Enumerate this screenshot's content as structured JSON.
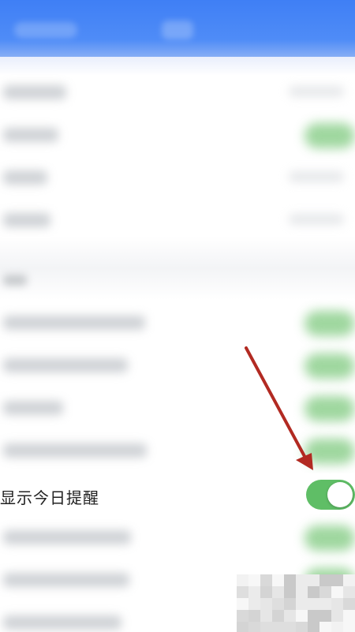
{
  "settings": {
    "highlighted_row": {
      "label": "显示今日提醒",
      "toggle_on": true
    }
  },
  "colors": {
    "appbar": "#3f7ff5",
    "toggle_on": "#5fbe66",
    "arrow": "#b22a22",
    "label_text": "#222222"
  }
}
